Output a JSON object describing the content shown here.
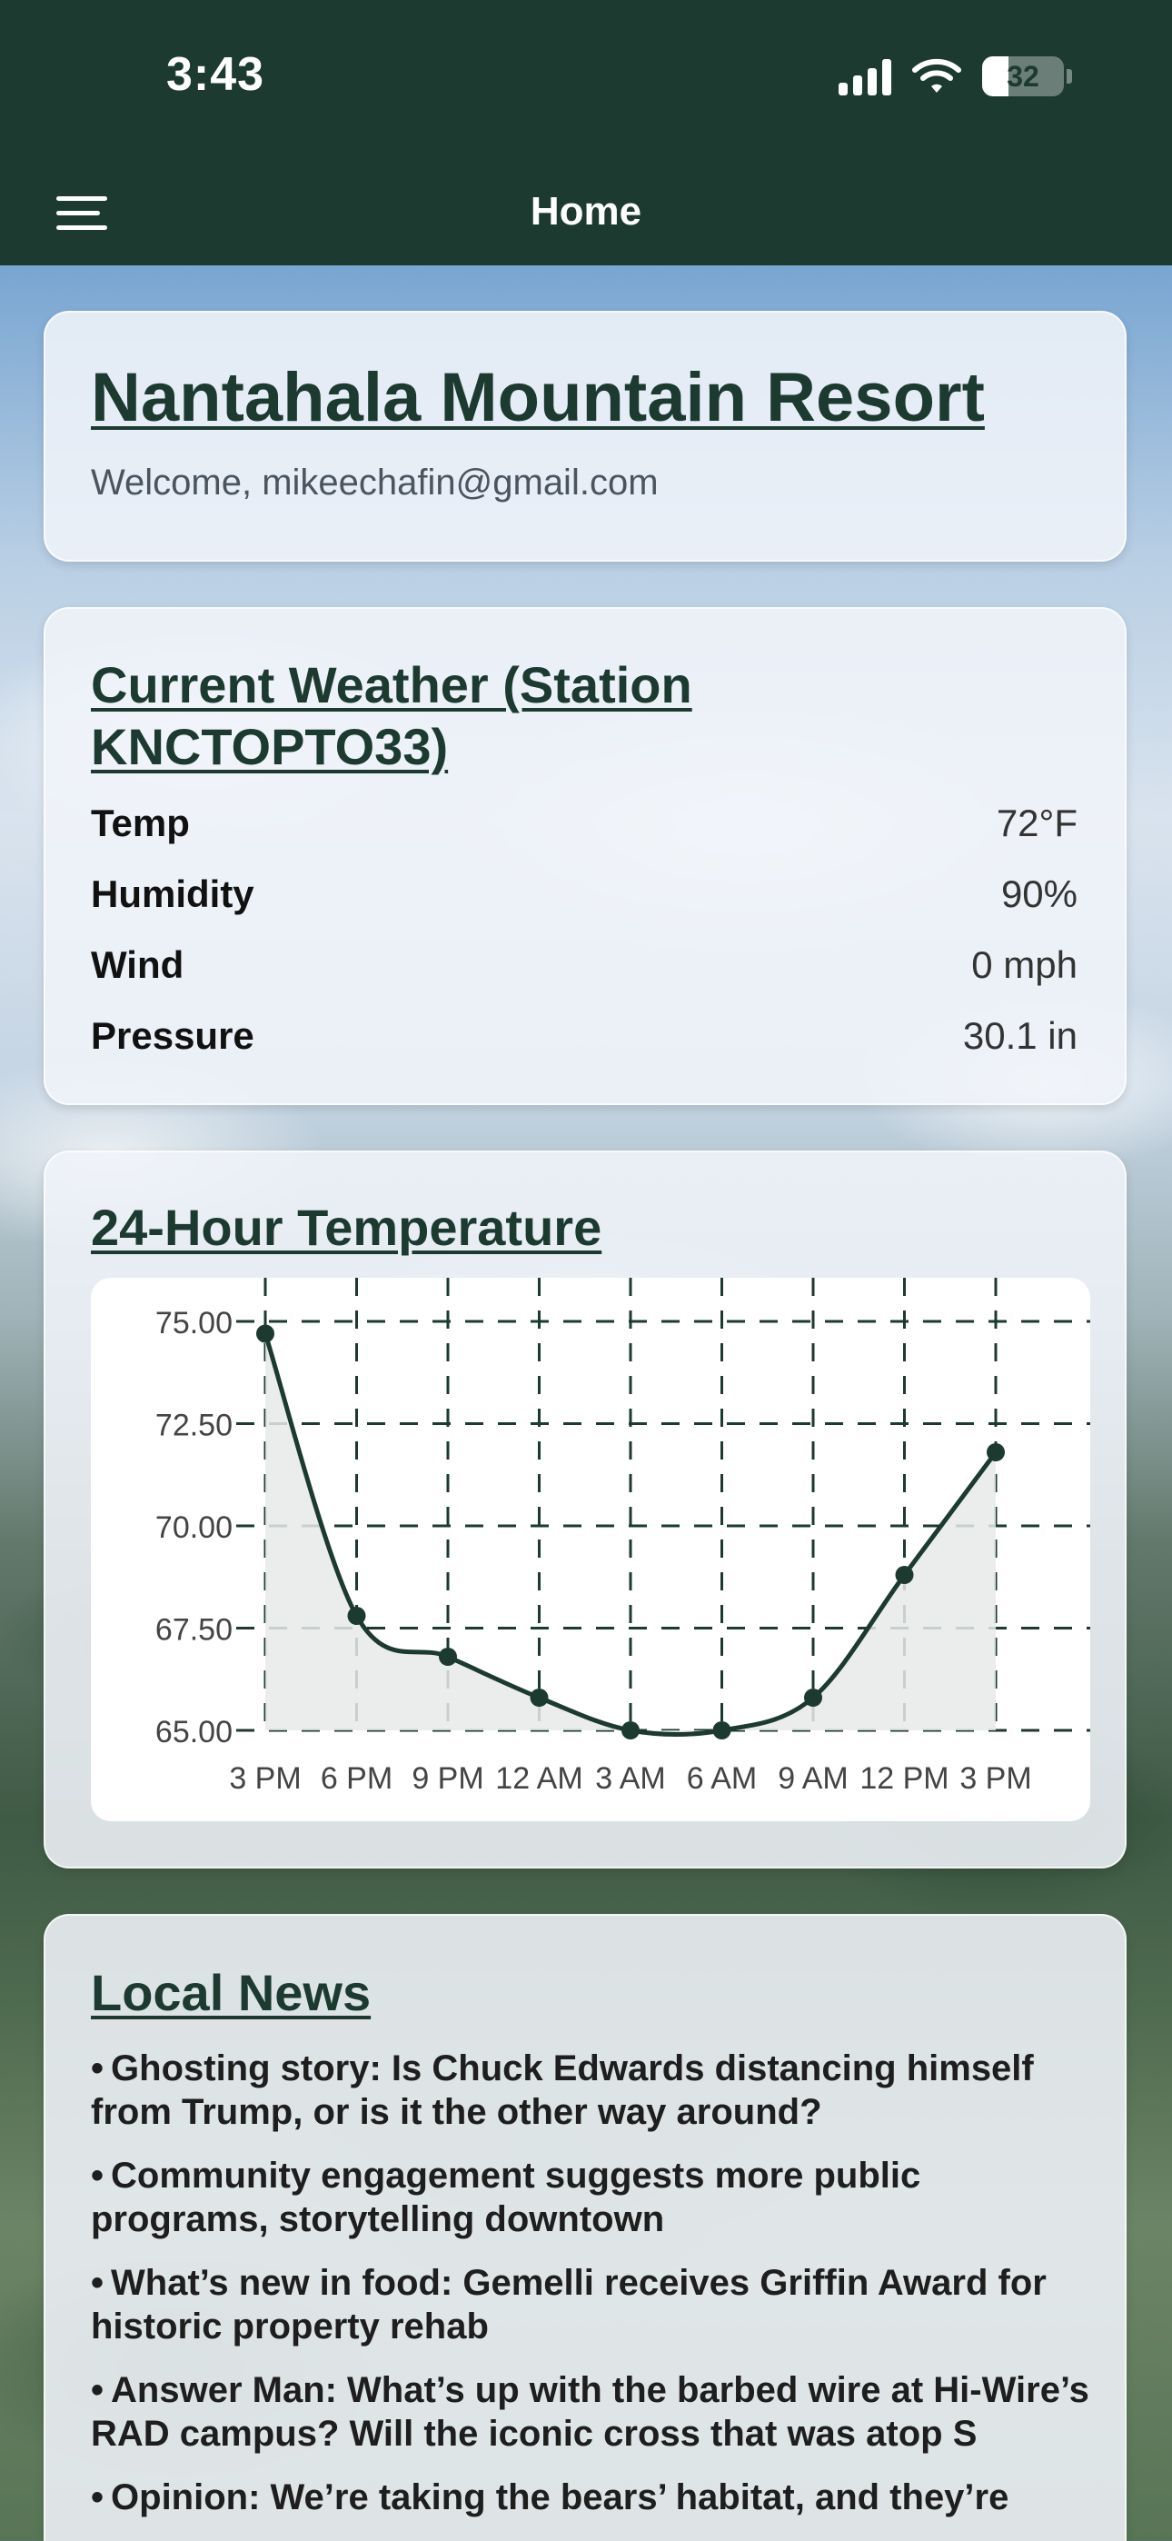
{
  "status_bar": {
    "time": "3:43",
    "battery": "32"
  },
  "nav": {
    "title": "Home"
  },
  "resort": {
    "name": "Nantahala Mountain Resort",
    "welcome": "Welcome, mikeechafin@gmail.com"
  },
  "weather": {
    "title": "Current Weather (Station KNCTOPTO33)",
    "rows": [
      {
        "label": "Temp",
        "value": "72°F"
      },
      {
        "label": "Humidity",
        "value": "90%"
      },
      {
        "label": "Wind",
        "value": "0 mph"
      },
      {
        "label": "Pressure",
        "value": "30.1 in"
      }
    ]
  },
  "temperature_card": {
    "title": "24-Hour Temperature"
  },
  "chart_data": {
    "type": "line",
    "categories": [
      "3 PM",
      "6 PM",
      "9 PM",
      "12 AM",
      "3 AM",
      "6 AM",
      "9 AM",
      "12 PM",
      "3 PM"
    ],
    "values": [
      74.7,
      67.8,
      66.8,
      65.8,
      65.0,
      65.0,
      65.8,
      68.8,
      71.8
    ],
    "y_ticks": [
      "75.00",
      "72.50",
      "70.00",
      "67.50",
      "65.00"
    ],
    "ylim": [
      65,
      75
    ],
    "grid": true,
    "colors": {
      "line": "#1c3a30",
      "fill": "#e8eaea",
      "grid": "#1c3a30"
    }
  },
  "news": {
    "title": "Local News",
    "bullet": "•",
    "items": [
      "Ghosting story: Is Chuck Edwards distancing himself from Trump, or is it the other way around?",
      "Community engagement suggests more public programs, storytelling downtown",
      "What’s new in food: Gemelli receives Griffin Award for historic property rehab",
      "Answer Man: What’s up with the barbed wire at Hi-Wire’s RAD campus? Will the iconic cross that was atop S",
      "Opinion: We’re taking the bears’ habitat, and they’re"
    ]
  },
  "colors": {
    "brand": "#1c3a30",
    "card_bg": "#f0f4f9"
  }
}
